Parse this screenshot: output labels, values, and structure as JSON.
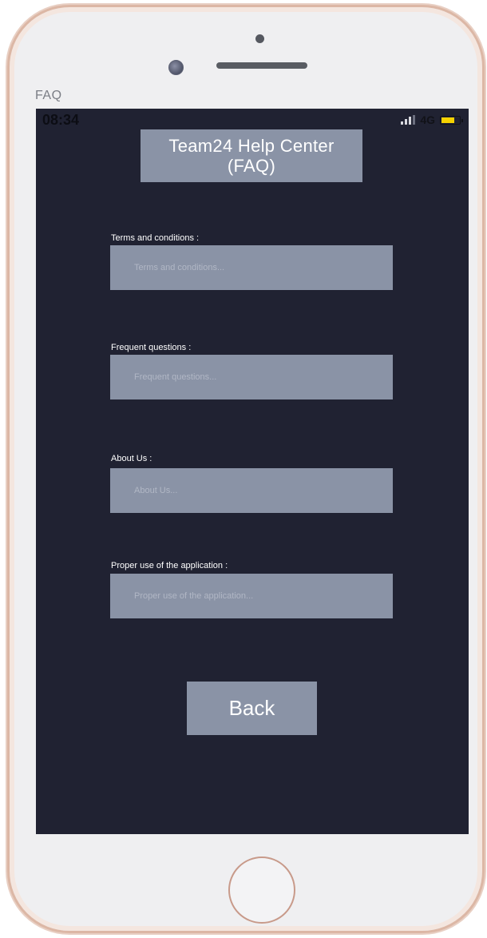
{
  "frame": {
    "label": "FAQ"
  },
  "status_bar": {
    "time": "08:34",
    "network": "4G"
  },
  "header": {
    "title_line1": "Team24 Help Center",
    "title_line2": "(FAQ)"
  },
  "fields": [
    {
      "label": "Terms and conditions :",
      "placeholder": "Terms and conditions..."
    },
    {
      "label": "Frequent questions :",
      "placeholder": "Frequent questions..."
    },
    {
      "label": "About Us :",
      "placeholder": "About Us..."
    },
    {
      "label": "Proper use of the application :",
      "placeholder": "Proper use of the application..."
    }
  ],
  "actions": {
    "back_label": "Back"
  },
  "icons": {
    "signal": "signal-bars-icon",
    "battery": "battery-icon",
    "camera": "front-camera-icon",
    "home": "home-button-icon"
  },
  "colors": {
    "screen_background": "#202232",
    "panel": "#8a93a6",
    "battery_fill": "#f6d200"
  }
}
